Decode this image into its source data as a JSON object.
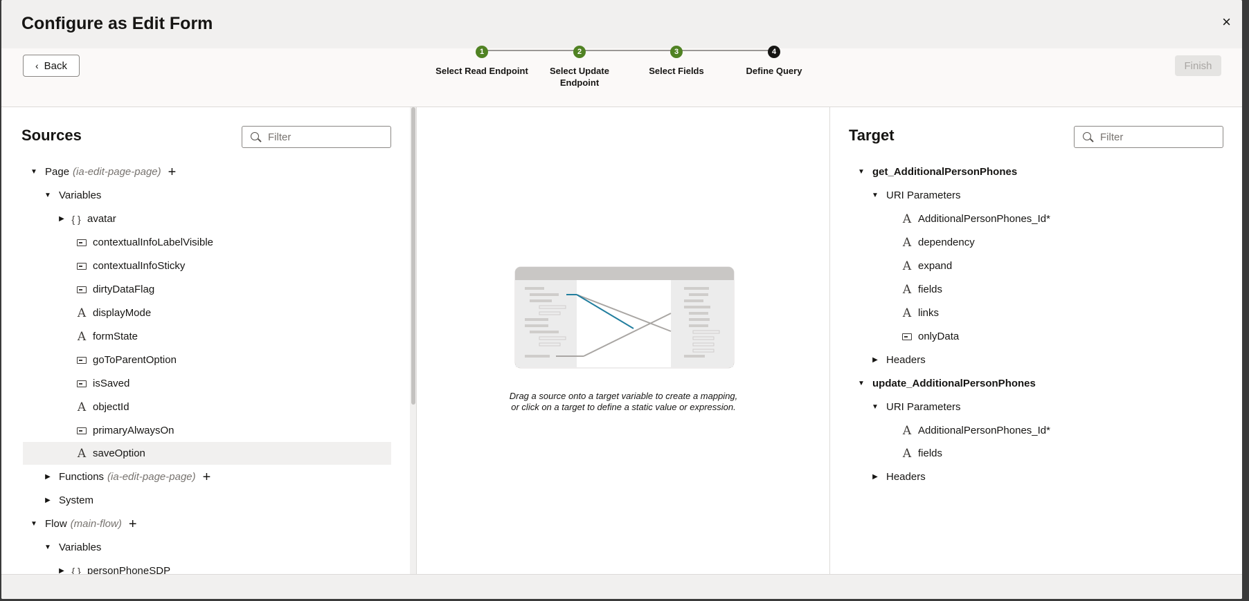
{
  "dialog": {
    "title": "Configure as Edit Form",
    "close_glyph": "×"
  },
  "wizard": {
    "back_label": "Back",
    "finish_label": "Finish",
    "steps": [
      {
        "num": "1",
        "label": "Select Read Endpoint",
        "state": "done"
      },
      {
        "num": "2",
        "label": "Select Update Endpoint",
        "state": "done"
      },
      {
        "num": "3",
        "label": "Select Fields",
        "state": "done"
      },
      {
        "num": "4",
        "label": "Define Query",
        "state": "current"
      }
    ]
  },
  "sources": {
    "title": "Sources",
    "filter_placeholder": "Filter",
    "page": {
      "label": "Page",
      "context": "(ia-edit-page-page)"
    },
    "page_variables_label": "Variables",
    "page_vars": [
      "avatar",
      "contextualInfoLabelVisible",
      "contextualInfoSticky",
      "dirtyDataFlag",
      "displayMode",
      "formState",
      "goToParentOption",
      "isSaved",
      "objectId",
      "primaryAlwaysOn",
      "saveOption"
    ],
    "functions": {
      "label": "Functions",
      "context": "(ia-edit-page-page)"
    },
    "system_label": "System",
    "flow": {
      "label": "Flow",
      "context": "(main-flow)"
    },
    "flow_variables_label": "Variables",
    "flow_vars": [
      "personPhoneSDP"
    ]
  },
  "mapper": {
    "hint_line1": "Drag a source onto a target variable to create a mapping,",
    "hint_line2": "or click on a target to define a static value or expression."
  },
  "target": {
    "title": "Target",
    "filter_placeholder": "Filter",
    "get": {
      "label": "get_AdditionalPersonPhones",
      "uri_label": "URI Parameters",
      "params": [
        "AdditionalPersonPhones_Id*",
        "dependency",
        "expand",
        "fields",
        "links",
        "onlyData"
      ],
      "headers_label": "Headers"
    },
    "update": {
      "label": "update_AdditionalPersonPhones",
      "uri_label": "URI Parameters",
      "params": [
        "AdditionalPersonPhones_Id*",
        "fields"
      ],
      "headers_label": "Headers"
    }
  },
  "colors": {
    "step_done": "#508223",
    "step_current": "#161513",
    "mapping_line": "#227e9e"
  }
}
